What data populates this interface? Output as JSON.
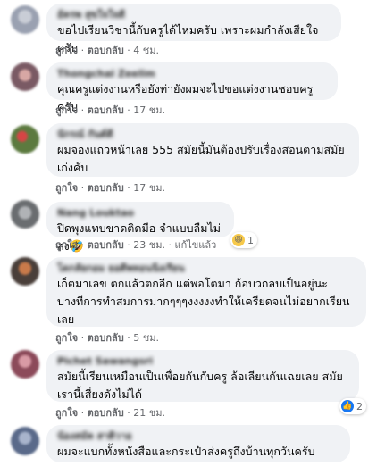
{
  "actions": {
    "like": "ถูกใจ",
    "reply": "ตอบกลับ",
    "separator": "·",
    "edited": "แก้ไขแล้ว"
  },
  "comments": [
    {
      "author": "อัครพ สุขใจใจดี",
      "text": "ขอไปเรียนวิชานี้กับครูได้ไหมครับ เพราะผมกำลังเสียใจครับ",
      "time": "4 ชม.",
      "avatar_color": "#9aa1b1"
    },
    {
      "author": "Thongchai Zeelim",
      "text": "คุณครูแต่งงานหรือยังท่ายังผมจะไปขอแต่งงานชอบครูครับ",
      "time": "17 ชม.",
      "avatar_color": "#7a5a64"
    },
    {
      "author": "นักรณ์ กันต์ดี",
      "text": "ผมจองแถวหน้าเลย 555 สมัยนี้มันต้องปรับเรื่องสอนตามสมัย\nเก่งคับ",
      "time": "17 ชม.",
      "avatar_color": "#5c7a3f"
    },
    {
      "author": "Nang Louktao",
      "text": "ปิดพุงแทบขาดติดมือ จำแบบลืมไม่ลง",
      "time": "23 ชม.",
      "edited": true,
      "reaction_count": "1",
      "avatar_color": "#6a6d70"
    },
    {
      "author": "โดกลัยกอม ยอดีพทอนนิ่งเรียน",
      "text": "เก็ตมาเลข ตกแล้วตกอีก แต่พอโตมา ก้อบวกลบเป็นอยู่นะ\nบางทีการทำสมการมากๆๆๆงงงงงทำให้เครียดจนไม่อยากเรียน\nเลย",
      "time": "5 ชม.",
      "avatar_color": "#4a3f3a"
    },
    {
      "author": "Pichet Sawangsri",
      "text": "สมัยนี้เรียนเหมือนเป็นเพื่อยกันกับครู ล้อเลียนกันเฉยเลย สมัย\nเรานี้เสี่ยงดังไม่ได้",
      "time": "21 ชม.",
      "reaction_count": "2",
      "avatar_color": "#8c4a5a"
    },
    {
      "author": "น้องสมัค สาดิวาอ",
      "text": "ผมจะแบกทั้งหนังสือและกระเป๋าส่งครูถึงบ้านทุกวันครับ",
      "avatar_color": "#5a6a8a"
    }
  ]
}
